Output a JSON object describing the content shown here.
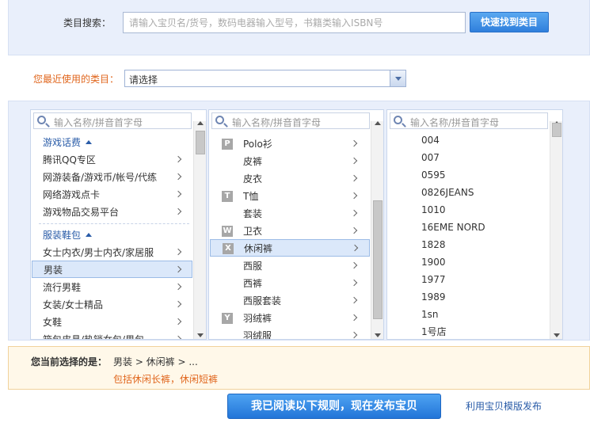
{
  "search": {
    "label": "类目搜索：",
    "placeholder": "请输入宝贝名/货号，数码电器输入型号，书籍类输入ISBN号",
    "button": "快速找到类目"
  },
  "recent": {
    "label": "您最近使用的类目：",
    "value": "请选择"
  },
  "columns": {
    "search_placeholder": "输入名称/拼音首字母",
    "col1": {
      "group1": "游戏话费",
      "group1_items": [
        "腾讯QQ专区",
        "网游装备/游戏币/帐号/代练",
        "网络游戏点卡",
        "游戏物品交易平台"
      ],
      "group2": "服装鞋包",
      "group2_items": [
        "女士内衣/男士内衣/家居服",
        "男装",
        "流行男鞋",
        "女装/女士精品",
        "女鞋",
        "箱包皮具/热销女包/男包"
      ]
    },
    "col2": {
      "items": [
        {
          "letter": "P",
          "label": "Polo衫"
        },
        {
          "letter": "",
          "label": "皮裤"
        },
        {
          "letter": "",
          "label": "皮衣"
        },
        {
          "letter": "T",
          "label": "T恤"
        },
        {
          "letter": "",
          "label": "套装"
        },
        {
          "letter": "W",
          "label": "卫衣"
        },
        {
          "letter": "X",
          "label": "休闲裤"
        },
        {
          "letter": "",
          "label": "西服"
        },
        {
          "letter": "",
          "label": "西裤"
        },
        {
          "letter": "",
          "label": "西服套装"
        },
        {
          "letter": "Y",
          "label": "羽绒裤"
        },
        {
          "letter": "",
          "label": "羽绒服"
        }
      ]
    },
    "col3": {
      "items": [
        "004",
        "007",
        "0595",
        "0826JEANS",
        "1010",
        "16EME NORD",
        "1828",
        "1900",
        "1977",
        "1989",
        "1sn",
        "1号店"
      ]
    }
  },
  "selection": {
    "label": "您当前选择的是：",
    "path": "男装 > 休闲裤 > ...",
    "hint": "包括休闲长裤，休闲短裤"
  },
  "actions": {
    "publish": "我已阅读以下规则，现在发布宝贝",
    "template_link": "利用宝贝模版发布"
  }
}
